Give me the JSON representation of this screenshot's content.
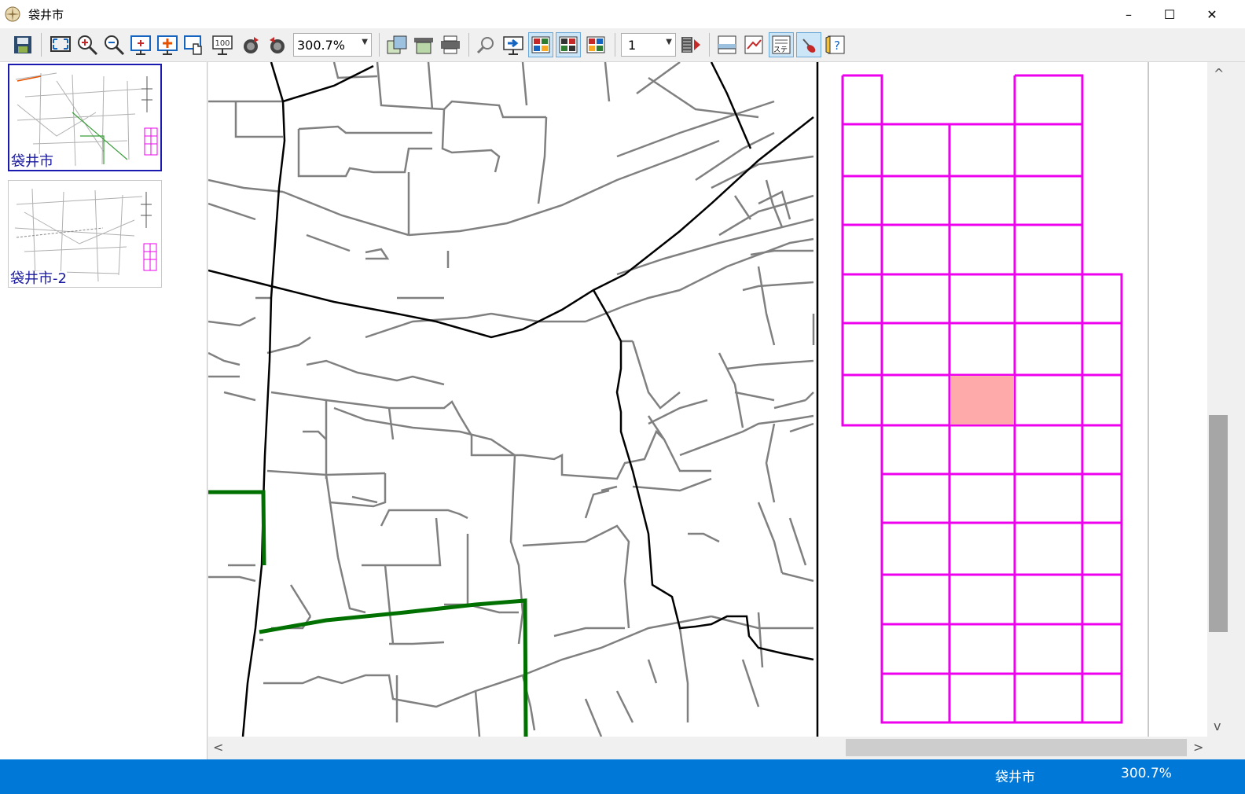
{
  "window": {
    "title": "袋井市",
    "minimize": "–",
    "maximize": "☐",
    "close": "✕"
  },
  "toolbar": {
    "zoom_value": "300.7%",
    "page_value": "1",
    "stage_label": "ステ"
  },
  "thumbnails": [
    {
      "label": "袋井市"
    },
    {
      "label": "袋井市-2"
    }
  ],
  "scroll": {
    "left_arrow": "<",
    "right_arrow": ">",
    "up_arrow": "^",
    "down_arrow": "v"
  },
  "status": {
    "map_name": "袋井市",
    "zoom": "300.7%"
  },
  "colors": {
    "accent": "#0078d7",
    "grid": "#ee00ee",
    "highlight": "#ffaaaa",
    "route": "#007000"
  }
}
